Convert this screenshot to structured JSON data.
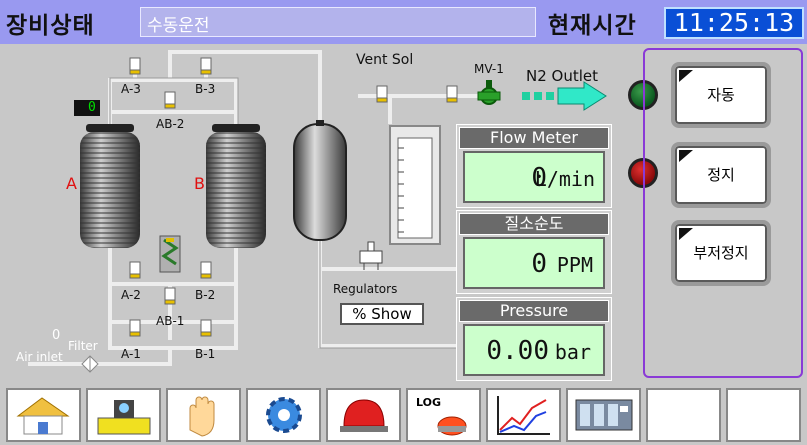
{
  "header": {
    "status_title": "장비상태",
    "mode_value": "수동운전",
    "time_title": "현재시간",
    "time_value": "11:25:13"
  },
  "diagram": {
    "counter": "0",
    "tank_a": "A",
    "tank_b": "B",
    "valves": {
      "a3": "A-3",
      "b3": "B-3",
      "ab2": "AB-2",
      "a2": "A-2",
      "b2": "B-2",
      "ab1": "AB-1",
      "a1": "A-1",
      "b1": "B-1"
    },
    "vent_sol": "Vent Sol",
    "mv1": "MV-1",
    "n2_outlet": "N2 Outlet",
    "regulators": "Regulators",
    "show_button": "% Show",
    "filter_zero": "0",
    "filter": "Filter",
    "air_inlet": "Air inlet"
  },
  "panels": {
    "flow": {
      "title": "Flow Meter",
      "value": "0",
      "unit": "L/min"
    },
    "purity": {
      "title": "질소순도",
      "value": "0",
      "unit": "PPM"
    },
    "pressure": {
      "title": "Pressure",
      "value": "0.00",
      "unit": "bar"
    }
  },
  "commands": {
    "auto": "자동",
    "stop": "정지",
    "partial_stop": "부저정지"
  },
  "toolbar": {
    "log_label": "LOG"
  },
  "colors": {
    "header_bg": "#9999f0",
    "clock_bg": "#0a4fd6",
    "panel_value_bg": "#ccffcc",
    "lamp_green": "#0b5a20",
    "lamp_red": "#8a0a0a",
    "tank_label": "#e01010"
  }
}
